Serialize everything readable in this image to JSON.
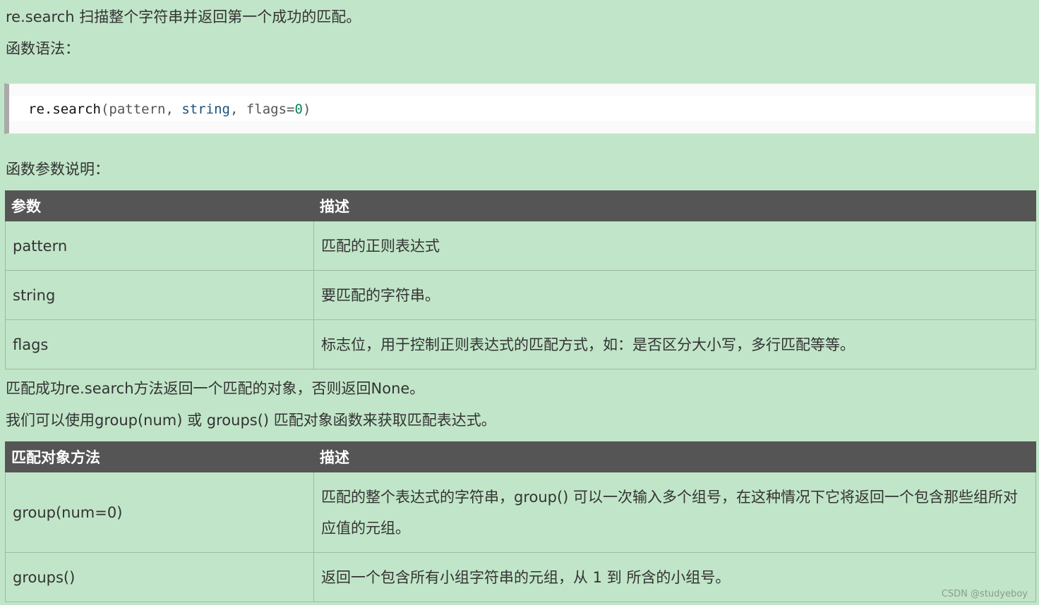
{
  "intro": {
    "line1": "re.search 扫描整个字符串并返回第一个成功的匹配。",
    "line2": "函数语法："
  },
  "code": {
    "p1": "re.search",
    "p2": "(pattern, ",
    "p3": "string",
    "p4": ", flags=",
    "p5": "0",
    "p6": ")"
  },
  "params_heading": "函数参数说明：",
  "params_table": {
    "headers": [
      "参数",
      "描述"
    ],
    "rows": [
      [
        "pattern",
        "匹配的正则表达式"
      ],
      [
        "string",
        "要匹配的字符串。"
      ],
      [
        "flags",
        "标志位，用于控制正则表达式的匹配方式，如：是否区分大小写，多行匹配等等。"
      ]
    ]
  },
  "after": {
    "line1": "匹配成功re.search方法返回一个匹配的对象，否则返回None。",
    "line2": "我们可以使用group(num) 或 groups() 匹配对象函数来获取匹配表达式。"
  },
  "methods_table": {
    "headers": [
      "匹配对象方法",
      "描述"
    ],
    "rows": [
      [
        "group(num=0)",
        "匹配的整个表达式的字符串，group() 可以一次输入多个组号，在这种情况下它将返回一个包含那些组所对应值的元组。"
      ],
      [
        "groups()",
        "返回一个包含所有小组字符串的元组，从 1 到 所含的小组号。"
      ]
    ]
  },
  "watermark": "CSDN @studyeboy"
}
